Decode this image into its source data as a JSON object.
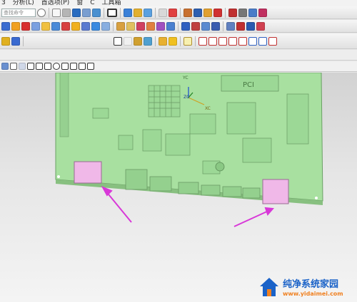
{
  "menu": {
    "analysis": "分析(L)",
    "preferences": "首选项(P)",
    "tools": "工具箱"
  },
  "search": {
    "placeholder": "查找命令"
  },
  "model": {
    "pcb_label": "PCI",
    "axis_z": "ZC",
    "axis_y": "YC",
    "axis_x": "XC"
  },
  "watermark": {
    "name": "纯净系统家园",
    "url": "www.yidaimei.com"
  },
  "colors": {
    "pcb": "#a8e0a0",
    "connector": "#f0b8e8",
    "arrow": "#d838d8",
    "wm_blue": "#1a62c8",
    "wm_orange": "#f08020"
  },
  "icons": {
    "toolbar_row1": [
      "search-icon",
      "grid-icon",
      "paint-icon",
      "cube-icon",
      "layer-icon",
      "rect-icon",
      "sketch-icon",
      "view-icon",
      "measure-icon",
      "snap-icon",
      "link-icon",
      "line-icon",
      "array-icon"
    ],
    "toolbar_row2": [
      "extrude-icon",
      "revolve-icon",
      "blend-icon",
      "chamfer-icon",
      "shell-icon",
      "hole-icon",
      "boolean-icon",
      "offset-icon",
      "trim-icon",
      "mirror-icon",
      "pattern-icon",
      "curve-icon",
      "spline-icon",
      "arc-icon"
    ],
    "toolbar_row3": [
      "brush-icon",
      "pencil-icon",
      "triangle-icon",
      "note-icon",
      "flag-icon",
      "folder-icon",
      "lamp-icon",
      "constraint-icon",
      "dimension-icon"
    ],
    "selection_bar": [
      "select-filter-icon",
      "point-icon",
      "line-snap-icon",
      "midpoint-icon",
      "arc-center-icon",
      "circle-icon",
      "quadrant-icon",
      "cross-icon",
      "tangent-icon"
    ]
  }
}
